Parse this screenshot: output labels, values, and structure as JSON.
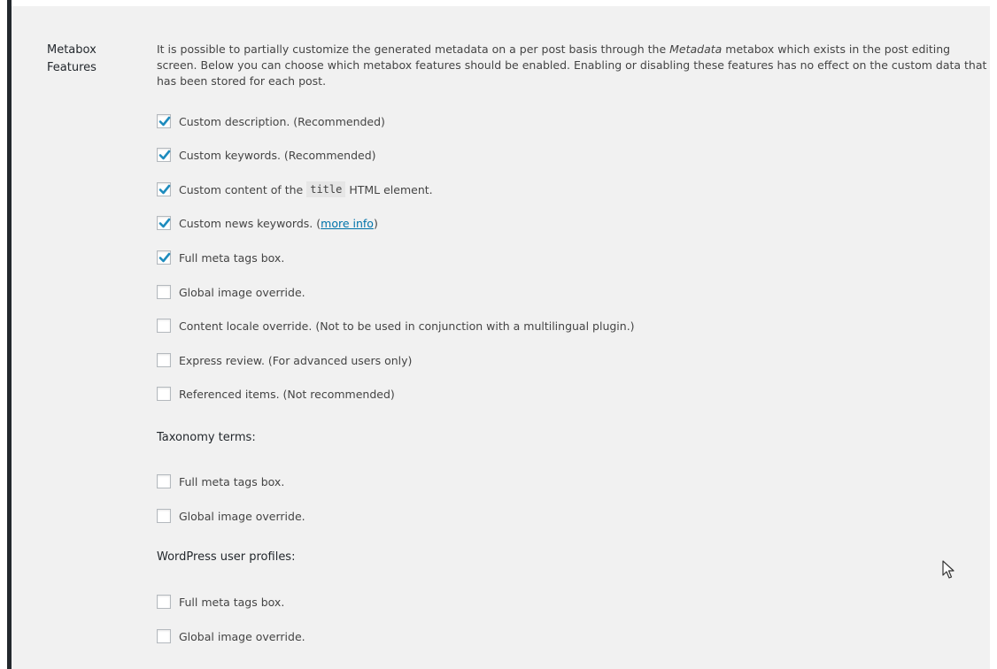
{
  "row_label": "Metabox Features",
  "description": {
    "part1": "It is possible to partially customize the generated metadata on a per post basis through the ",
    "em": "Metadata",
    "part2": " metabox which exists in the post editing screen. Below you can choose which metabox features should be enabled. Enabling or disabling these features has no effect on the custom data that has been stored for each post."
  },
  "post_options": [
    {
      "label": "Custom description. (Recommended)",
      "checked": true
    },
    {
      "label": "Custom keywords. (Recommended)",
      "checked": true
    },
    {
      "label_before": "Custom content of the",
      "code": "title",
      "label_after": "HTML element.",
      "checked": true
    },
    {
      "label": "Custom news keywords. (",
      "link": "more info",
      "label_after": ")",
      "checked": true
    },
    {
      "label": "Full meta tags box.",
      "checked": true
    },
    {
      "label": "Global image override.",
      "checked": false
    },
    {
      "label": "Content locale override. (Not to be used in conjunction with a multilingual plugin.)",
      "checked": false
    },
    {
      "label": "Express review. (For advanced users only)",
      "checked": false
    },
    {
      "label": "Referenced items. (Not recommended)",
      "checked": false
    }
  ],
  "taxonomy": {
    "heading": "Taxonomy terms:",
    "options": [
      {
        "label": "Full meta tags box.",
        "checked": false
      },
      {
        "label": "Global image override.",
        "checked": false
      }
    ]
  },
  "user_profiles": {
    "heading": "WordPress user profiles:",
    "options": [
      {
        "label": "Full meta tags box.",
        "checked": false
      },
      {
        "label": "Global image override.",
        "checked": false
      }
    ]
  },
  "colors": {
    "accent": "#1e8cbe",
    "link": "#0073aa"
  }
}
